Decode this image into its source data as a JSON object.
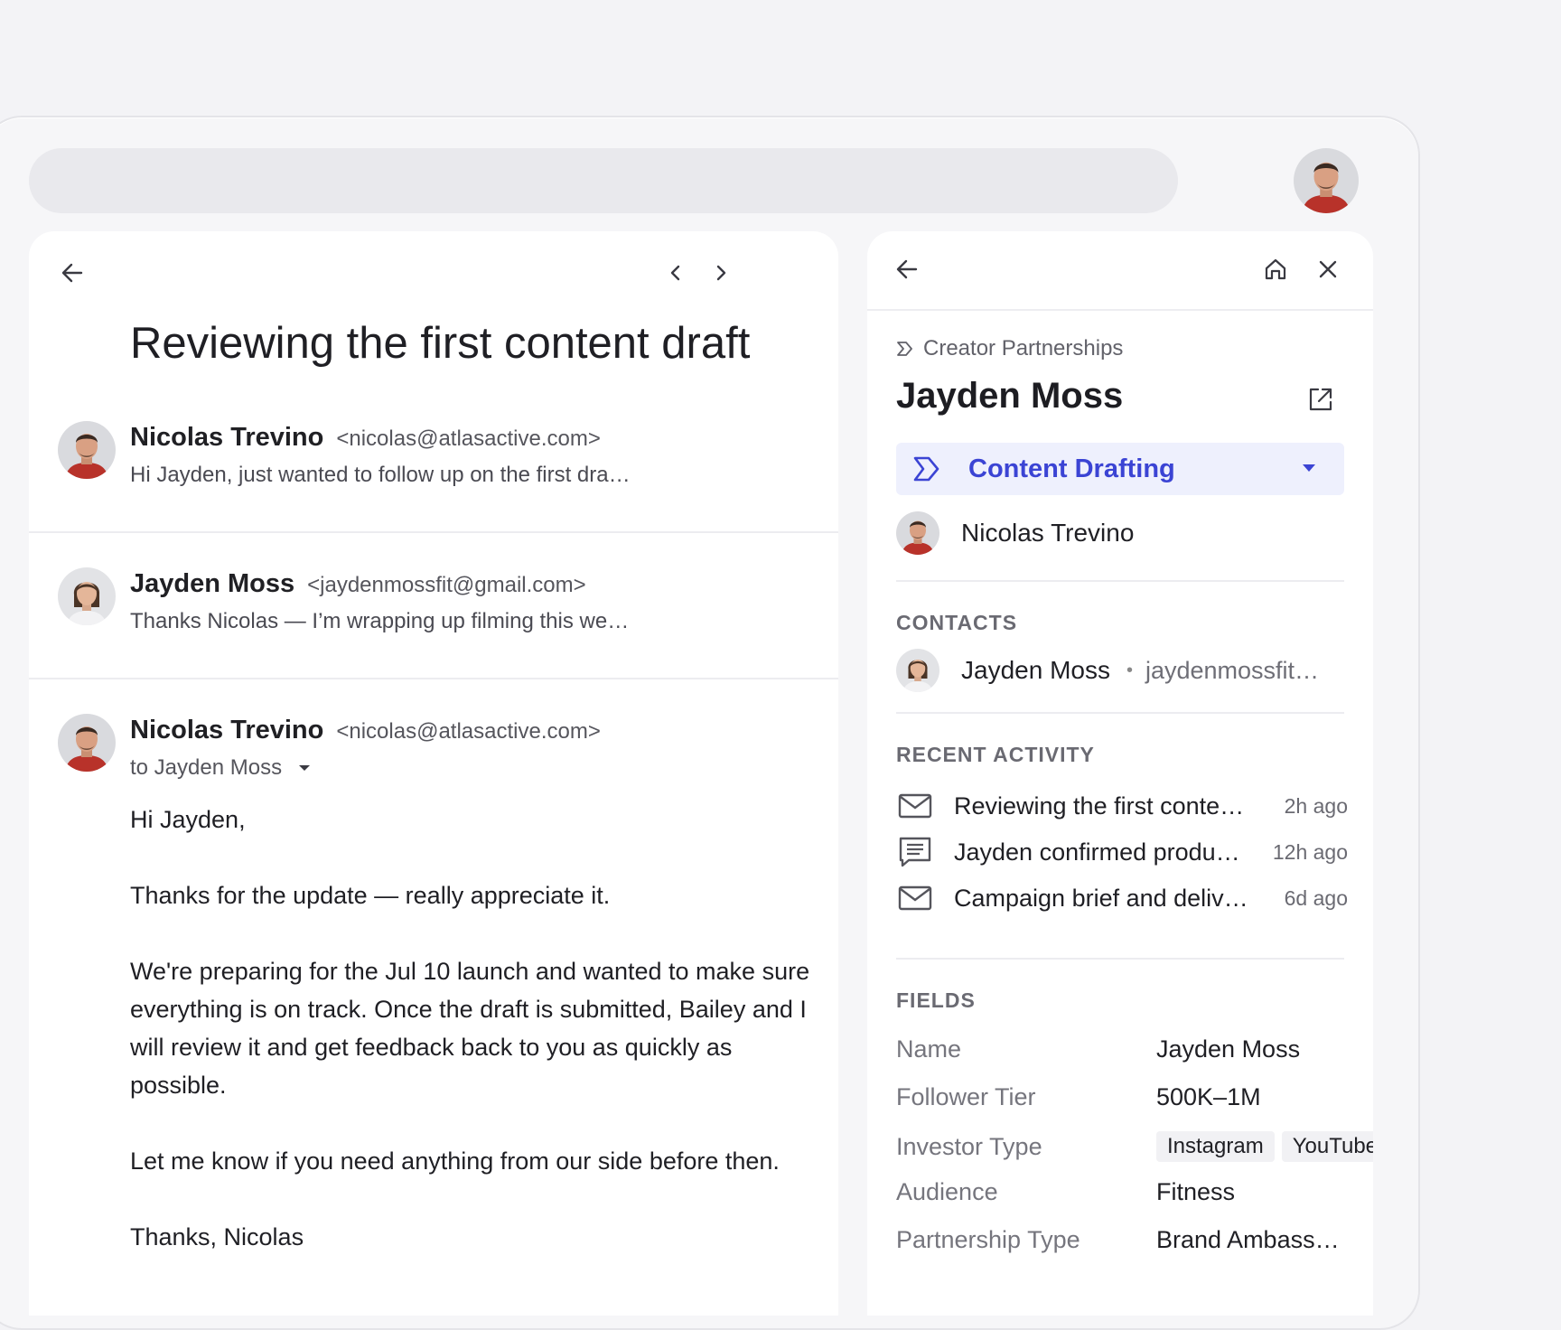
{
  "email": {
    "subject": "Reviewing the first content draft",
    "messages": [
      {
        "sender": "Nicolas Trevino",
        "address": "<nicolas@atlasactive.com>",
        "snippet": "Hi Jayden, just wanted to follow up on the first dra…"
      },
      {
        "sender": "Jayden Moss",
        "address": "<jaydenmossfit@gmail.com>",
        "snippet": "Thanks Nicolas — I’m wrapping up filming this we…"
      },
      {
        "sender": "Nicolas Trevino",
        "address": "<nicolas@atlasactive.com>",
        "to": "to Jayden Moss",
        "body": [
          "Hi Jayden,",
          "Thanks for the update — really appreciate it.",
          "We're preparing for the Jul 10 launch and wanted to make sure everything is on track. Once the draft is submitted, Bailey and I will review it and get feedback back to you as quickly as possible.",
          "Let me know if you need anything from our side before then.",
          "Thanks, Nicolas"
        ]
      }
    ]
  },
  "crm": {
    "breadcrumb": "Creator Partnerships",
    "title": "Jayden Moss",
    "stage": "Content Drafting",
    "owner": "Nicolas Trevino",
    "contacts_label": "CONTACTS",
    "contact": {
      "name": "Jayden Moss",
      "email": "jaydenmossfit…"
    },
    "activity_label": "RECENT ACTIVITY",
    "activities": [
      {
        "icon": "mail-icon",
        "text": "Reviewing the first conte…",
        "time": "2h ago"
      },
      {
        "icon": "note-icon",
        "text": "Jayden confirmed produ…",
        "time": "12h ago"
      },
      {
        "icon": "mail-icon",
        "text": "Campaign brief and deliv…",
        "time": "6d ago"
      }
    ],
    "fields_label": "FIELDS",
    "fields": [
      {
        "label": "Name",
        "value": "Jayden Moss"
      },
      {
        "label": "Follower Tier",
        "value": "500K–1M"
      },
      {
        "label": "Investor Type",
        "tags": [
          "Instagram",
          "YouTube"
        ]
      },
      {
        "label": "Audience",
        "value": "Fitness"
      },
      {
        "label": "Partnership Type",
        "value": "Brand Ambass…"
      }
    ]
  },
  "colors": {
    "accent": "#3b44d4",
    "stage_bg": "#eef0fd",
    "panel_bg": "#ffffff",
    "page_bg": "#f3f3f6"
  }
}
